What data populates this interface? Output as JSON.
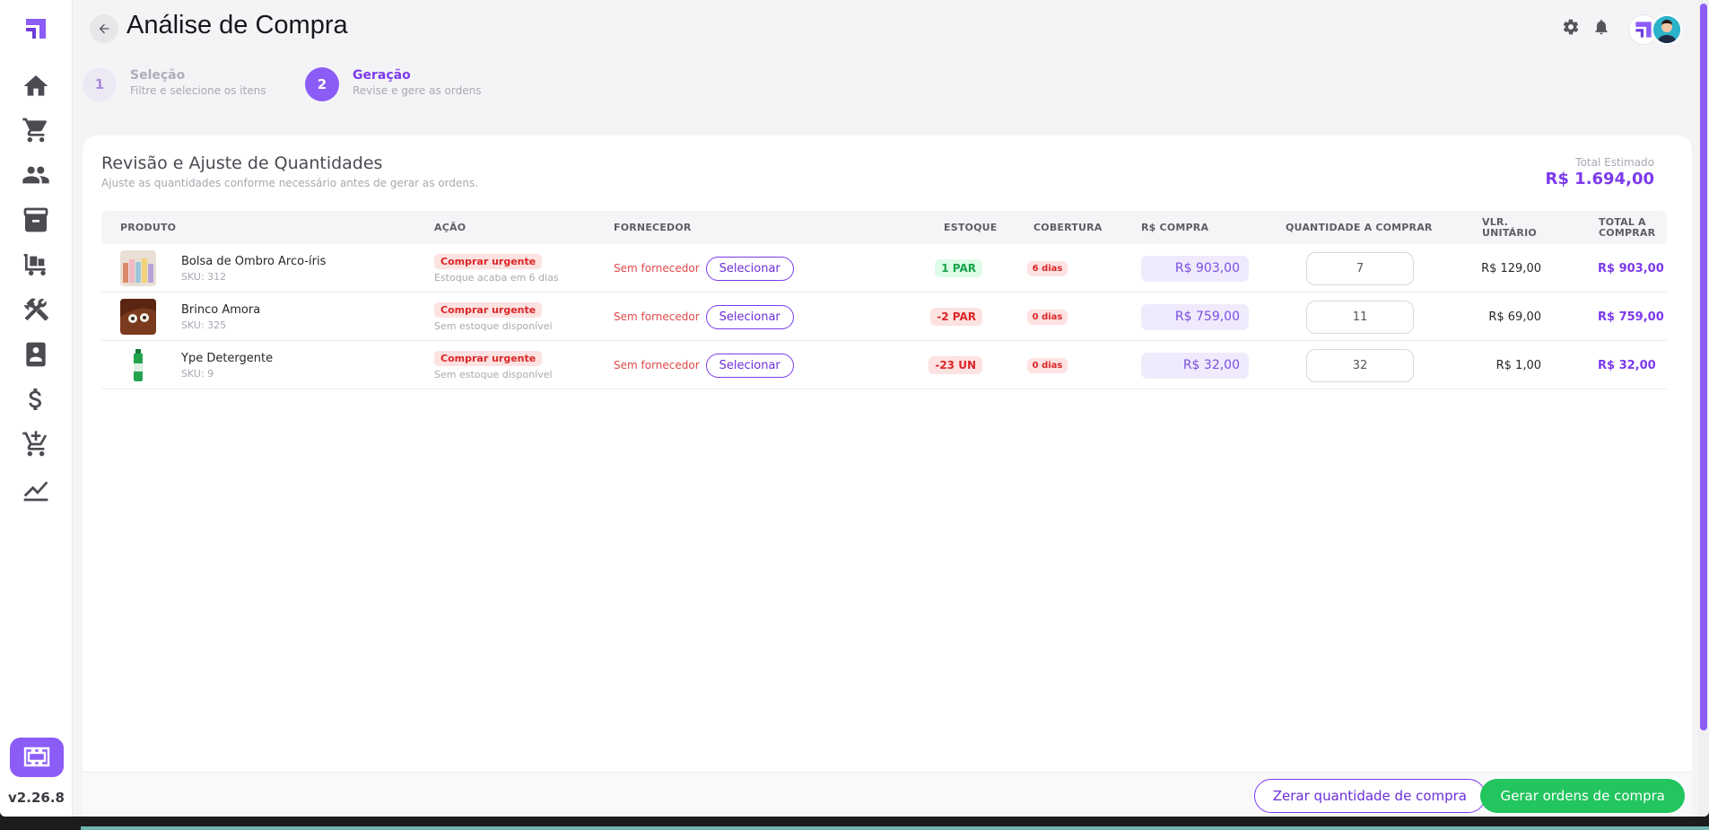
{
  "app": {
    "version": "v2.26.8",
    "colors": {
      "accent": "#7c3aed",
      "success": "#22c55e",
      "danger": "#dc2626"
    }
  },
  "sidebar": {
    "items": [
      {
        "name": "home",
        "icon": "home-icon"
      },
      {
        "name": "cart",
        "icon": "cart-icon"
      },
      {
        "name": "people",
        "icon": "people-icon"
      },
      {
        "name": "inventory",
        "icon": "box-icon"
      },
      {
        "name": "purchases",
        "icon": "trolley-icon"
      },
      {
        "name": "tools",
        "icon": "tools-icon"
      },
      {
        "name": "contacts",
        "icon": "badge-icon"
      },
      {
        "name": "finance",
        "icon": "dollar-icon"
      },
      {
        "name": "add-cart",
        "icon": "cart-plus-icon"
      },
      {
        "name": "reports",
        "icon": "chart-icon"
      }
    ]
  },
  "header": {
    "title": "Análise de Compra"
  },
  "stepper": {
    "steps": [
      {
        "number": "1",
        "label": "Seleção",
        "sub": "Filtre e selecione os itens",
        "active": false
      },
      {
        "number": "2",
        "label": "Geração",
        "sub": "Revise e gere as ordens",
        "active": true
      }
    ]
  },
  "card": {
    "title": "Revisão e Ajuste de Quantidades",
    "subtitle": "Ajuste as quantidades conforme necessário antes de gerar as ordens.",
    "total_label": "Total Estimado",
    "total_value": "R$ 1.694,00"
  },
  "table": {
    "columns": {
      "produto": "PRODUTO",
      "acao": "AÇÃO",
      "fornecedor": "FORNECEDOR",
      "estoque": "ESTOQUE",
      "cobertura": "COBERTURA",
      "compra": "R$ COMPRA",
      "quantidade": "QUANTIDADE A COMPRAR",
      "unitario": "VLR. UNITÁRIO",
      "total": "TOTAL A COMPRAR"
    },
    "rows": [
      {
        "name": "Bolsa de Ombro Arco-íris",
        "sku": "SKU: 312",
        "action": "Comprar urgente",
        "action_sub": "Estoque acaba em 6 dias",
        "supplier": "Sem fornecedor",
        "select_label": "Selecionar",
        "stock": "1 PAR",
        "stock_status": "positive",
        "coverage": "6 dias",
        "buy_value": "R$ 903,00",
        "quantity": "7",
        "unit_value": "R$ 129,00",
        "total": "R$ 903,00"
      },
      {
        "name": "Brinco Amora",
        "sku": "SKU: 325",
        "action": "Comprar urgente",
        "action_sub": "Sem estoque disponível",
        "supplier": "Sem fornecedor",
        "select_label": "Selecionar",
        "stock": "-2 PAR",
        "stock_status": "negative",
        "coverage": "0 dias",
        "buy_value": "R$ 759,00",
        "quantity": "11",
        "unit_value": "R$ 69,00",
        "total": "R$ 759,00"
      },
      {
        "name": "Ype Detergente",
        "sku": "SKU: 9",
        "action": "Comprar urgente",
        "action_sub": "Sem estoque disponível",
        "supplier": "Sem fornecedor",
        "select_label": "Selecionar",
        "stock": "-23 UN",
        "stock_status": "negative",
        "coverage": "0 dias",
        "buy_value": "R$ 32,00",
        "quantity": "32",
        "unit_value": "R$ 1,00",
        "total": "R$ 32,00"
      }
    ]
  },
  "footer": {
    "reset_label": "Zerar quantidade de compra",
    "generate_label": "Gerar ordens de compra"
  }
}
